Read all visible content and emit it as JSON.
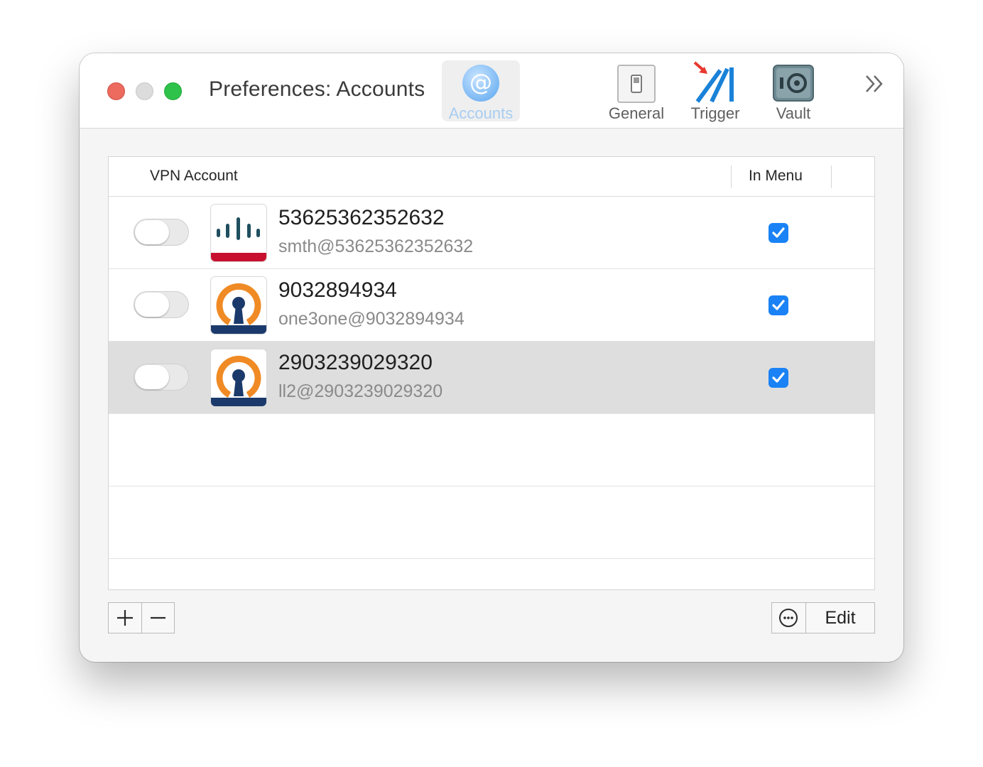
{
  "window": {
    "title": "Preferences: Accounts"
  },
  "toolbar": {
    "items": [
      {
        "label": "Accounts",
        "icon": "at-sign-icon",
        "selected": true
      },
      {
        "label": "General",
        "icon": "light-switch-icon"
      },
      {
        "label": "Trigger",
        "icon": "trigger-icon"
      },
      {
        "label": "Vault",
        "icon": "vault-icon"
      }
    ],
    "overflow_icon": "chevron-double-right-icon"
  },
  "table": {
    "columns": {
      "account": "VPN Account",
      "in_menu": "In Menu"
    },
    "rows": [
      {
        "name": "53625362352632",
        "detail": "smth@53625362352632",
        "type": "cisco",
        "enabled": false,
        "in_menu": true,
        "selected": false
      },
      {
        "name": "9032894934",
        "detail": "one3one@9032894934",
        "type": "openvpn",
        "enabled": false,
        "in_menu": true,
        "selected": false
      },
      {
        "name": "2903239029320",
        "detail": "ll2@2903239029320",
        "type": "openvpn",
        "enabled": false,
        "in_menu": true,
        "selected": true
      }
    ]
  },
  "footer": {
    "add_icon": "plus-icon",
    "remove_icon": "minus-icon",
    "more_icon": "ellipsis-circle-icon",
    "edit_label": "Edit"
  },
  "colors": {
    "accent": "#1a82f5",
    "cisco_red": "#c8102e",
    "cisco_teal": "#1f4f5f",
    "openvpn_orange": "#f08a24",
    "openvpn_navy": "#1b3a6b"
  }
}
